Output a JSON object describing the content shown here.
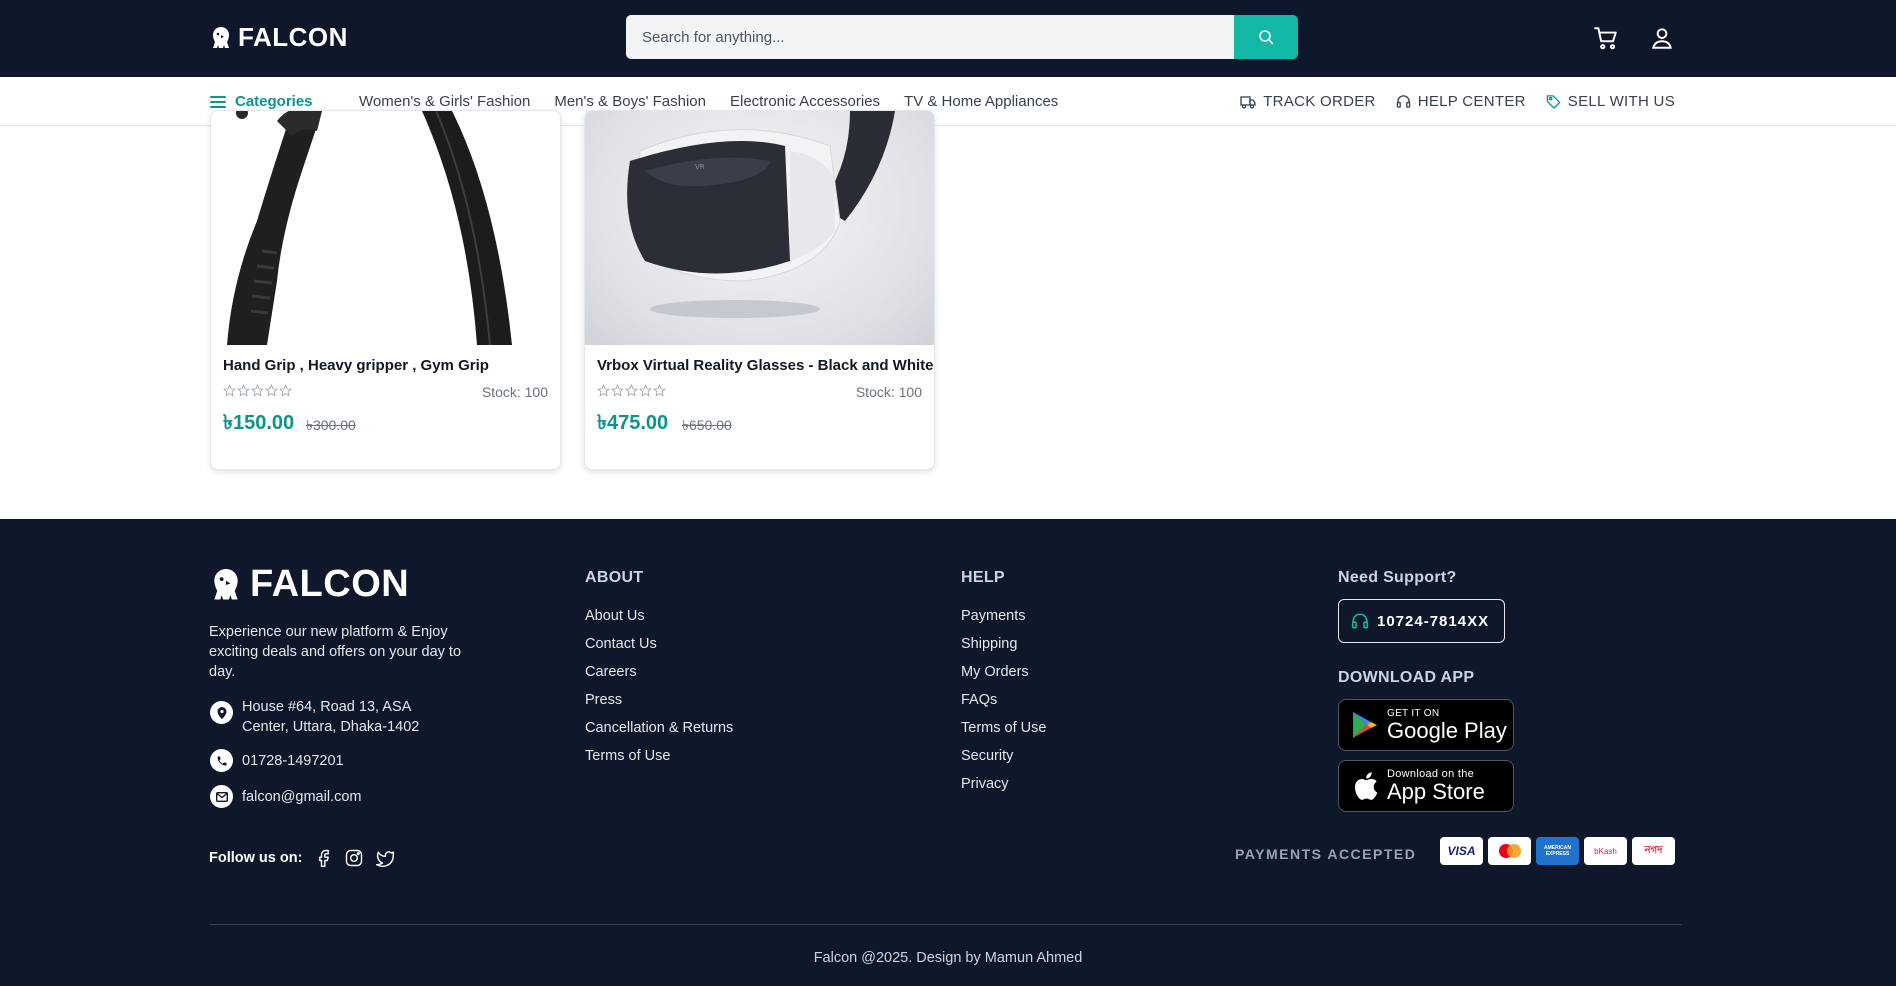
{
  "header": {
    "logo_text": "FALCON",
    "search_placeholder": "Search for anything...",
    "search_icon": "search-icon",
    "cart_icon": "cart-icon",
    "user_icon": "user-icon",
    "accent_color": "#14b8a6",
    "bg_color": "#0f172a"
  },
  "nav": {
    "categories_label": "Categories",
    "links": [
      "Women's & Girls' Fashion",
      "Men's & Boys' Fashion",
      "Electronic Accessories",
      "TV & Home Appliances"
    ],
    "right": [
      {
        "label": "TRACK ORDER",
        "icon": "truck-icon"
      },
      {
        "label": "HELP CENTER",
        "icon": "headset-icon"
      },
      {
        "label": "SELL WITH US",
        "icon": "tag-icon"
      }
    ]
  },
  "products": [
    {
      "title": "Hand Grip , Heavy gripper , Gym Grip",
      "stock": "Stock: 100",
      "price": "৳150.00",
      "old_price": "৳300.00",
      "rating": 0
    },
    {
      "title": "Vrbox Virtual Reality Glasses - Black and White",
      "stock": "Stock: 100",
      "price": "৳475.00",
      "old_price": "৳650.00",
      "rating": 0
    }
  ],
  "footer": {
    "logo_text": "FALCON",
    "description": "Experience our new platform & Enjoy exciting deals and offers on your day to day.",
    "address_line1": "House #64, Road 13, ASA",
    "address_line2": "Center, Uttara, Dhaka-1402",
    "phone": "01728-1497201",
    "email": "falcon@gmail.com",
    "follow_label": "Follow us on:",
    "about": {
      "title": "ABOUT",
      "links": [
        "About Us",
        "Contact Us",
        "Careers",
        "Press",
        "Cancellation & Returns",
        "Terms of Use"
      ]
    },
    "help": {
      "title": "HELP",
      "links": [
        "Payments",
        "Shipping",
        "My Orders",
        "FAQs",
        "Terms of Use",
        "Security",
        "Privacy"
      ]
    },
    "support_title": "Need Support?",
    "support_phone": "10724-7814XX",
    "download_title": "DOWNLOAD APP",
    "google_small": "GET IT ON",
    "google_big": "Google Play",
    "apple_small": "Download on the",
    "apple_big": "App Store",
    "payments_label": "PAYMENTS ACCEPTED",
    "payment_methods": [
      "VISA",
      "mastercard",
      "AMERICAN EXPRESS",
      "bKash",
      "নগদ"
    ],
    "copyright": "Falcon @2025. Design by Mamun Ahmed"
  }
}
